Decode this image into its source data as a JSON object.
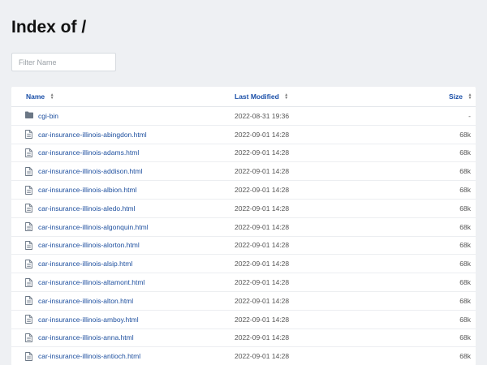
{
  "page": {
    "title": "Index of /"
  },
  "filter": {
    "placeholder": "Filter Name"
  },
  "table": {
    "columns": {
      "name": "Name",
      "modified": "Last Modified",
      "size": "Size"
    },
    "rows": [
      {
        "name": "cgi-bin",
        "modified": "2022-08-31 19:36",
        "size": "-",
        "type": "folder-icon"
      },
      {
        "name": "car-insurance-illinois-abingdon.html",
        "modified": "2022-09-01 14:28",
        "size": "68k",
        "type": "file-icon"
      },
      {
        "name": "car-insurance-illinois-adams.html",
        "modified": "2022-09-01 14:28",
        "size": "68k",
        "type": "file-icon"
      },
      {
        "name": "car-insurance-illinois-addison.html",
        "modified": "2022-09-01 14:28",
        "size": "68k",
        "type": "file-icon"
      },
      {
        "name": "car-insurance-illinois-albion.html",
        "modified": "2022-09-01 14:28",
        "size": "68k",
        "type": "file-icon"
      },
      {
        "name": "car-insurance-illinois-aledo.html",
        "modified": "2022-09-01 14:28",
        "size": "68k",
        "type": "file-icon"
      },
      {
        "name": "car-insurance-illinois-algonquin.html",
        "modified": "2022-09-01 14:28",
        "size": "68k",
        "type": "file-icon"
      },
      {
        "name": "car-insurance-illinois-alorton.html",
        "modified": "2022-09-01 14:28",
        "size": "68k",
        "type": "file-icon"
      },
      {
        "name": "car-insurance-illinois-alsip.html",
        "modified": "2022-09-01 14:28",
        "size": "68k",
        "type": "file-icon"
      },
      {
        "name": "car-insurance-illinois-altamont.html",
        "modified": "2022-09-01 14:28",
        "size": "68k",
        "type": "file-icon"
      },
      {
        "name": "car-insurance-illinois-alton.html",
        "modified": "2022-09-01 14:28",
        "size": "68k",
        "type": "file-icon"
      },
      {
        "name": "car-insurance-illinois-amboy.html",
        "modified": "2022-09-01 14:28",
        "size": "68k",
        "type": "file-icon"
      },
      {
        "name": "car-insurance-illinois-anna.html",
        "modified": "2022-09-01 14:28",
        "size": "68k",
        "type": "file-icon"
      },
      {
        "name": "car-insurance-illinois-antioch.html",
        "modified": "2022-09-01 14:28",
        "size": "68k",
        "type": "file-icon"
      }
    ]
  },
  "colors": {
    "background": "#eef0f3",
    "link": "#1c4e9e",
    "header_link": "#1a4fa8"
  }
}
